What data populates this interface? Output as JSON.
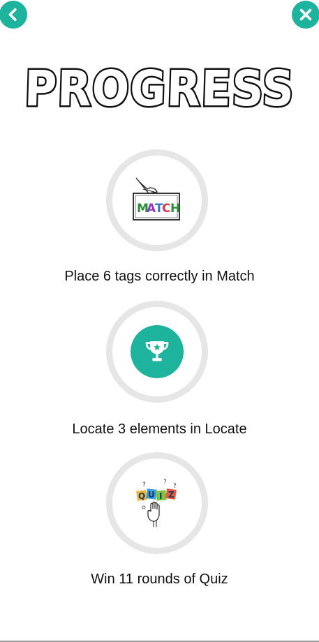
{
  "header": {
    "back_icon": "chevron-left-icon",
    "close_icon": "close-icon",
    "accent": "#1db39c"
  },
  "title": "PROGRESS",
  "achievements": [
    {
      "icon": "match-card-icon",
      "label": "Place 6 tags correctly in Match",
      "match_text": "MATCH"
    },
    {
      "icon": "trophy-icon",
      "label": "Locate 3 elements in Locate"
    },
    {
      "icon": "quiz-icon",
      "label": "Win 11 rounds of Quiz",
      "quiz_letters": [
        "Q",
        "U",
        "I",
        "Z"
      ]
    }
  ]
}
